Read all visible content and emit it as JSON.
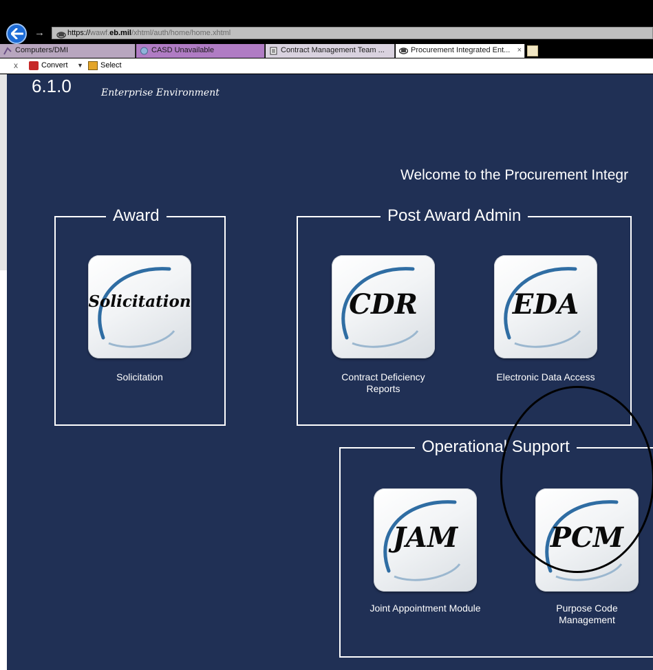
{
  "browser": {
    "url": {
      "scheme": "https://",
      "host_prefix": "wawf.",
      "host": "eb.mil",
      "path": "/xhtml/auth/home/home.xhtml"
    },
    "tabs": [
      {
        "label": "Computers/DMI"
      },
      {
        "label": "CASD Unavailable"
      },
      {
        "label": "Contract Management Team ..."
      },
      {
        "label": "Procurement Integrated Ent...",
        "active": true,
        "close": "×"
      }
    ],
    "command_bar": {
      "close": "x",
      "convert_label": "Convert",
      "caret": "▼",
      "select_label": "Select"
    }
  },
  "page": {
    "version": "6.1.0",
    "environment": "Enterprise Environment",
    "welcome": "Welcome to the Procurement Integr",
    "background_color": "#203055",
    "groups": {
      "award": {
        "title": "Award",
        "items": [
          {
            "tile_text": "Solicitation",
            "caption": "Solicitation"
          }
        ]
      },
      "post_award": {
        "title": "Post Award Admin",
        "items": [
          {
            "tile_text": "CDR",
            "caption": "Contract Deficiency Reports"
          },
          {
            "tile_text": "EDA",
            "caption": "Electronic Data Access"
          }
        ]
      },
      "operational": {
        "title": "Operational Support",
        "items": [
          {
            "tile_text": "JAM",
            "caption": "Joint Appointment Module"
          },
          {
            "tile_text": "PCM",
            "caption": "Purpose Code Management"
          }
        ]
      }
    }
  },
  "icons": {
    "back": "back-arrow-icon",
    "forward": "forward-arrow-icon",
    "page": "page-icon",
    "convert": "pdf-convert-icon",
    "select": "select-icon",
    "new_tab": "new-tab-icon"
  }
}
